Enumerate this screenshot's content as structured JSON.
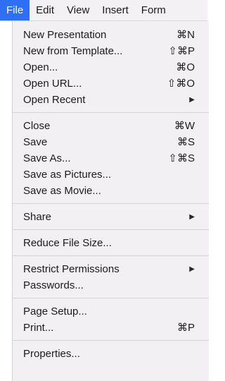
{
  "menubar": {
    "items": [
      "File",
      "Edit",
      "View",
      "Insert",
      "Form"
    ]
  },
  "menu": {
    "groups": [
      [
        {
          "label": "New Presentation",
          "shortcut": "⌘N"
        },
        {
          "label": "New from Template...",
          "shortcut": "⇧⌘P"
        },
        {
          "label": "Open...",
          "shortcut": "⌘O"
        },
        {
          "label": "Open URL...",
          "shortcut": "⇧⌘O"
        },
        {
          "label": "Open Recent",
          "submenu": "▶"
        }
      ],
      [
        {
          "label": "Close",
          "shortcut": "⌘W"
        },
        {
          "label": "Save",
          "shortcut": "⌘S"
        },
        {
          "label": "Save As...",
          "shortcut": "⇧⌘S"
        },
        {
          "label": "Save as Pictures..."
        },
        {
          "label": "Save as Movie..."
        }
      ],
      [
        {
          "label": "Share",
          "submenu": "▶"
        }
      ],
      [
        {
          "label": "Reduce File Size..."
        }
      ],
      [
        {
          "label": "Restrict Permissions",
          "submenu": "▶"
        },
        {
          "label": "Passwords..."
        }
      ],
      [
        {
          "label": "Page Setup..."
        },
        {
          "label": "Print...",
          "shortcut": "⌘P"
        }
      ],
      [
        {
          "label": "Properties..."
        }
      ]
    ]
  },
  "colors": {
    "active_menu": "#2f6ff5",
    "menu_background": "#f2f0f2",
    "separator": "#d6d4d6"
  }
}
